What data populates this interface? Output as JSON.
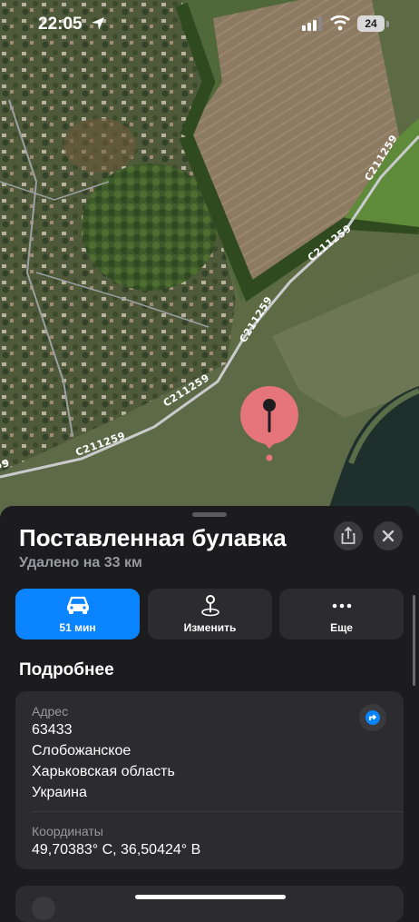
{
  "status_bar": {
    "time": "22:05",
    "battery": "24",
    "icons": [
      "location-arrow-icon",
      "cellular-signal-icon",
      "wifi-icon",
      "battery-icon"
    ]
  },
  "map": {
    "road_labels": [
      "C211259",
      "C211259",
      "C211259",
      "C211259",
      "C211259",
      "C211259"
    ],
    "pin_color": "#e5747b"
  },
  "sheet": {
    "title": "Поставленная булавка",
    "subtitle": "Удалено на 33 км",
    "share_icon": "share-icon",
    "close_icon": "close-icon",
    "actions": [
      {
        "label": "51 мин",
        "icon": "car-icon",
        "color": "#0a84ff"
      },
      {
        "label": "Изменить",
        "icon": "pin-edit-icon"
      },
      {
        "label": "Еще",
        "icon": "ellipsis-icon"
      }
    ],
    "details_header": "Подробнее",
    "address_label": "Адрес",
    "address_lines": [
      "63433",
      "Слобожанское",
      "Харьковская область",
      "Украина"
    ],
    "coords_label": "Координаты",
    "coords_value": "49,70383° С, 36,50424° В"
  }
}
